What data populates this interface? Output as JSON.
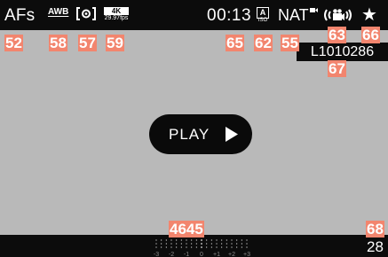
{
  "topbar": {
    "af_mode": "AFs",
    "white_balance": "AWB",
    "metering_icon": "spot-metering-icon",
    "resolution": "4K",
    "frame_rate": "29.97fps",
    "recording_time": "00:13",
    "iso_mode": "A",
    "iso_sub": "ISO",
    "film_style": "NAT",
    "stabilization_icon": "video-stabilization-icon",
    "favorite_icon": "star-icon"
  },
  "file": {
    "name": "L1010286"
  },
  "play_button": {
    "label": "PLAY",
    "icon": "play-triangle-icon"
  },
  "bottombar": {
    "scale_labels": [
      "-3",
      "-2",
      "-1",
      "0",
      "+1",
      "+2",
      "+3"
    ],
    "image_count": "28"
  },
  "callouts": {
    "c52": "52",
    "c58": "58",
    "c57": "57",
    "c59": "59",
    "c65": "65",
    "c62": "62",
    "c55": "55",
    "c63": "63",
    "c66": "66",
    "c67": "67",
    "c4645": "4645",
    "c68": "68"
  },
  "colors": {
    "callout": "#f2856e",
    "screen": "#b9b9b9",
    "bar": "#0c0c0c"
  }
}
